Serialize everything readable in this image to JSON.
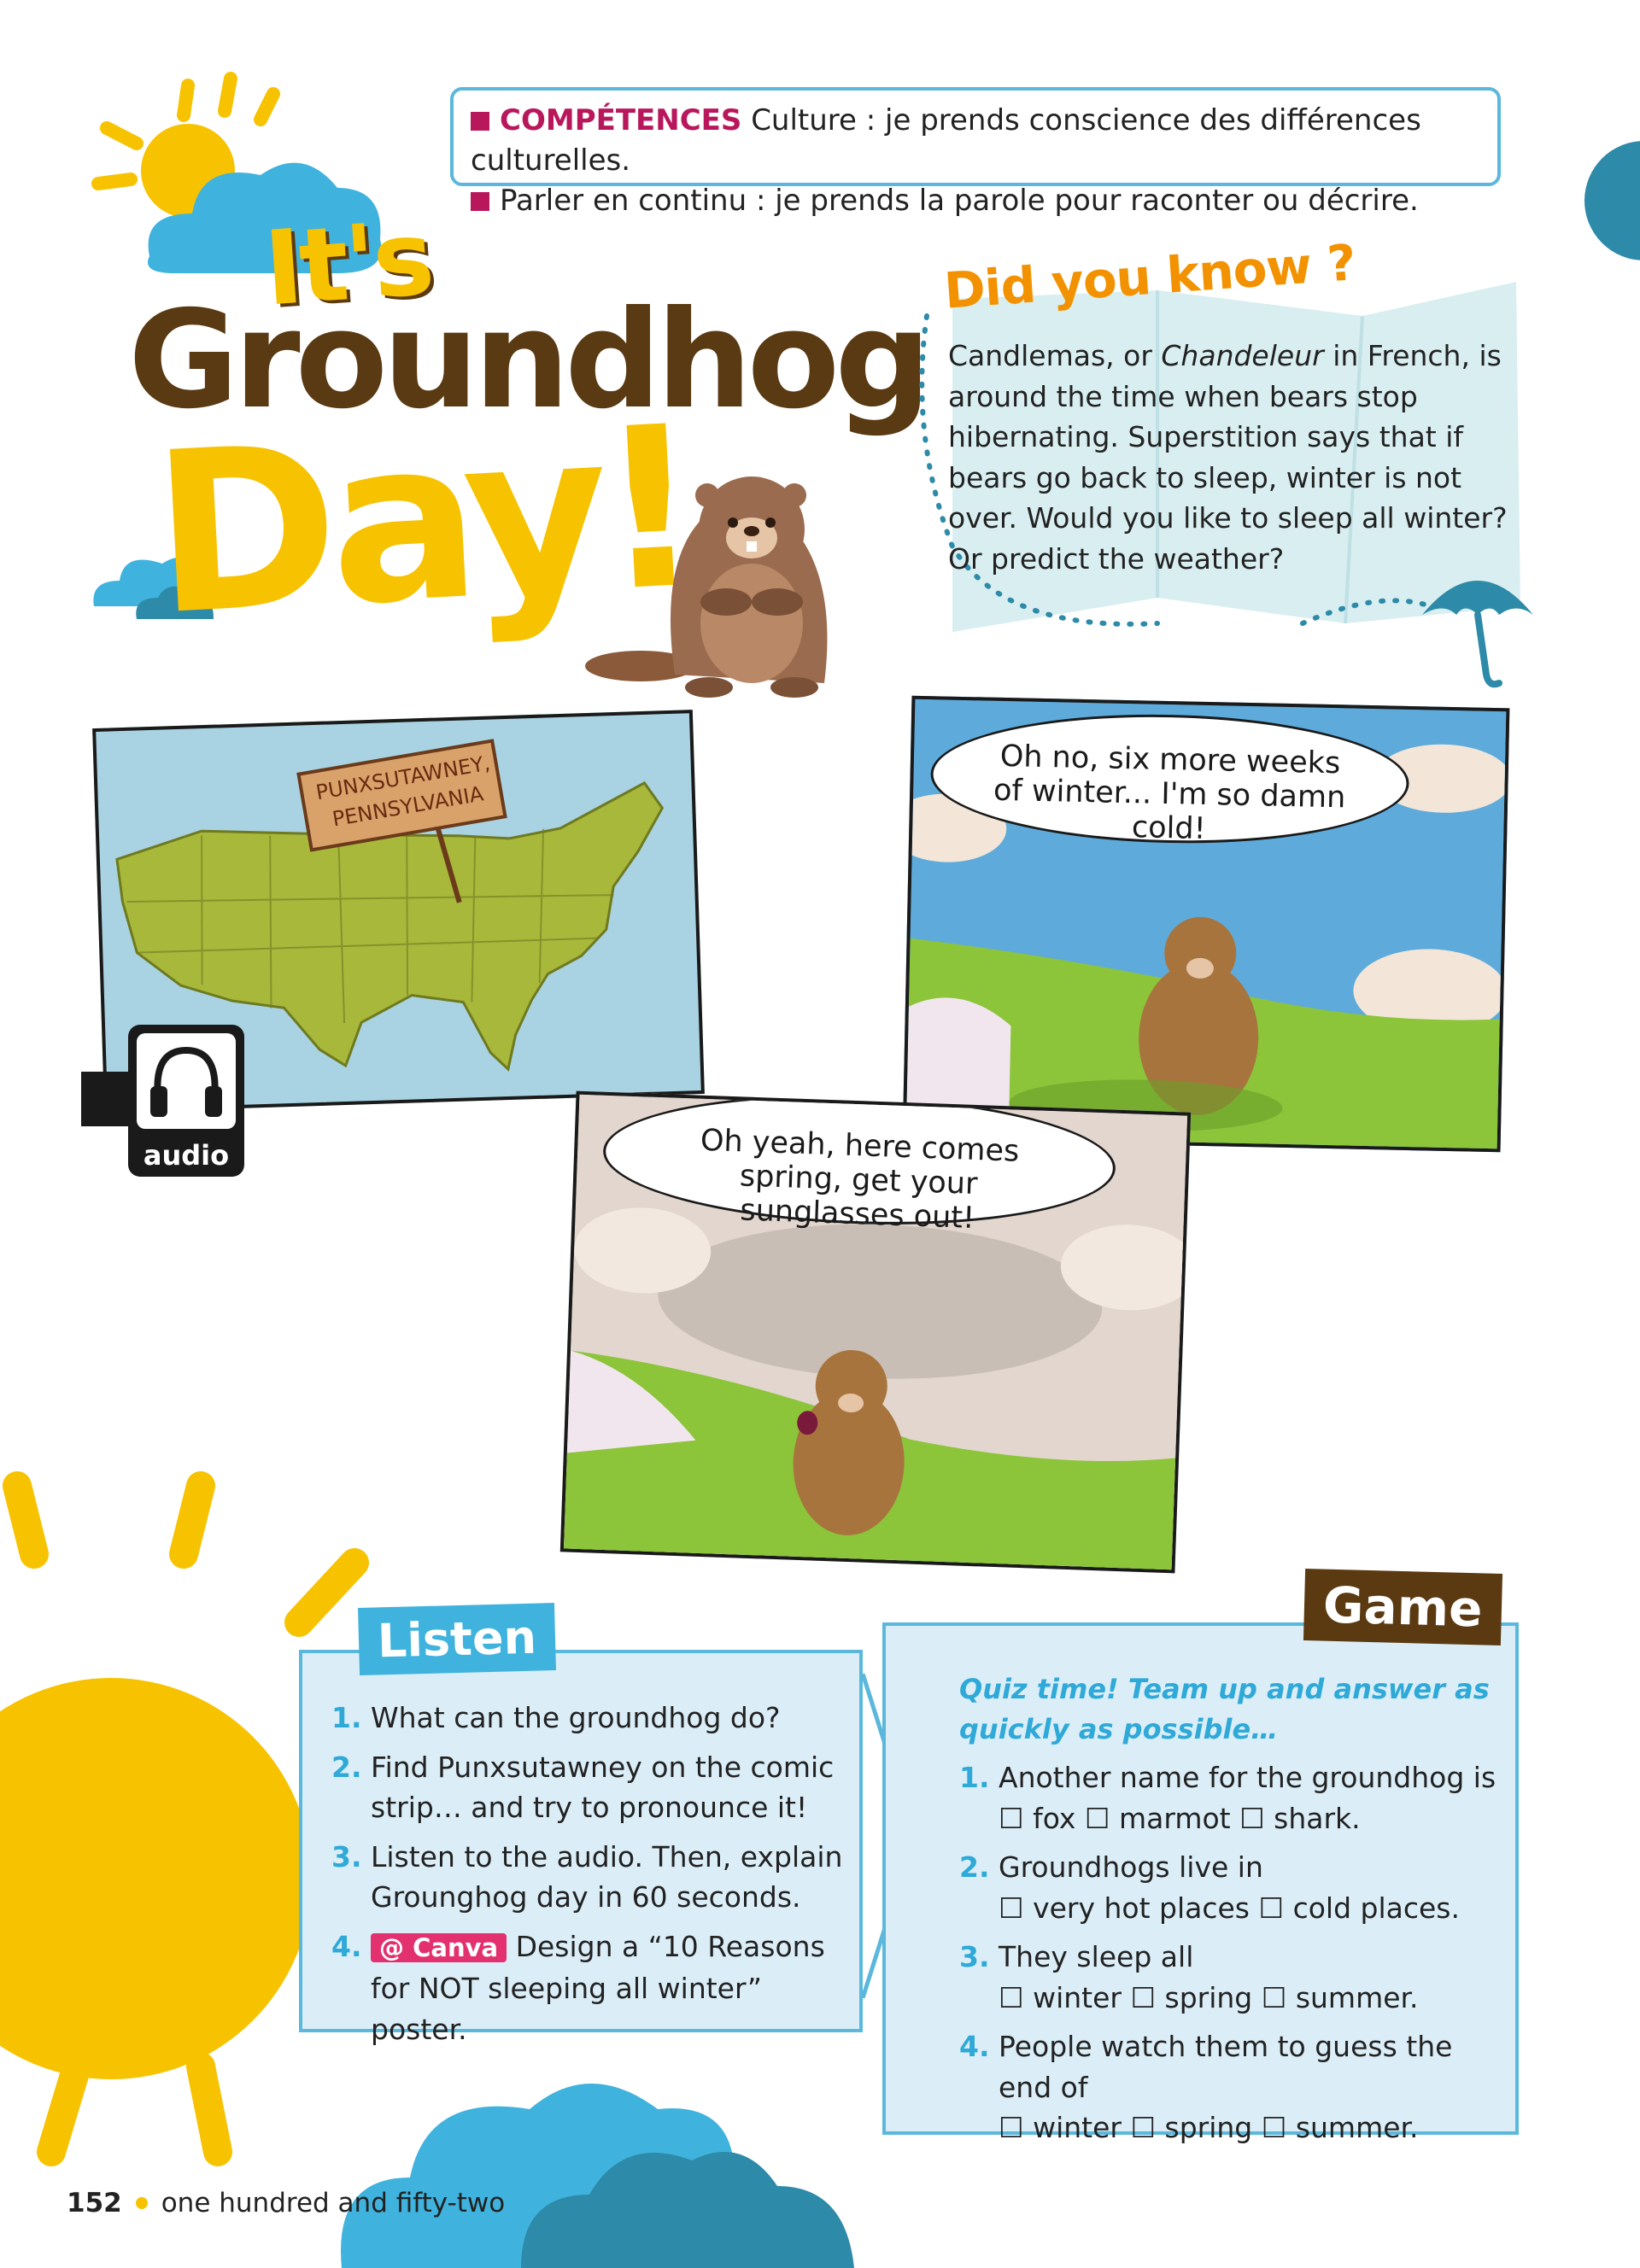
{
  "competences": {
    "label": "COMPÉTENCES",
    "line1": "Culture : je prends conscience des différences culturelles.",
    "line2": "Parler en continu : je prends la parole pour raconter ou décrire."
  },
  "title": {
    "line1": "It's",
    "line2": "Groundhog",
    "line3": "Day!"
  },
  "did_you_know": {
    "heading": "Did you know ?",
    "text_before": "Candlemas, or ",
    "text_italic": "Chandeleur",
    "text_after": " in French, is around the time when bears stop hibernating. Superstition says that if bears go back to sleep, winter is not over. Would you like to sleep all winter? Or predict the weather?"
  },
  "comic": {
    "sign_line1": "PUNXSUTAWNEY,",
    "sign_line2": "PENNSYLVANIA",
    "bubble1": "Oh no, six more weeks of winter... I'm so damn cold!",
    "bubble2": "Oh yeah, here comes spring, get your sunglasses out!"
  },
  "audio": {
    "label": "audio"
  },
  "listen": {
    "title": "Listen",
    "items": [
      {
        "num": "1.",
        "text": "What can the groundhog do?"
      },
      {
        "num": "2.",
        "text": "Find Punxsutawney on the comic strip… and try to pronounce it!"
      },
      {
        "num": "3.",
        "text": "Listen to the audio. Then, explain Grounghog day in 60 seconds."
      },
      {
        "num": "4.",
        "badge": "@ Canva",
        "text": "Design a “10 Reasons for NOT sleeping all winter” poster."
      }
    ]
  },
  "game": {
    "title": "Game",
    "intro": "Quiz time! Team up and answer as quickly as possible…",
    "items": [
      {
        "num": "1.",
        "q": "Another name for the groundhog is",
        "opts": "☐ fox ☐ marmot ☐ shark."
      },
      {
        "num": "2.",
        "q": "Groundhogs live in",
        "opts": "☐ very hot places ☐ cold places."
      },
      {
        "num": "3.",
        "q": "They sleep all",
        "opts": "☐ winter ☐ spring ☐ summer."
      },
      {
        "num": "4.",
        "q": "People watch them to guess the end of",
        "opts": "☐ winter ☐ spring ☐ summer."
      }
    ]
  },
  "footer": {
    "page_number": "152",
    "page_words": "one hundred and fifty-two"
  },
  "colors": {
    "accent_pink": "#b8175c",
    "blue": "#2fa9d8",
    "yellow": "#f7c300",
    "brown": "#5a3a12",
    "orange": "#f39200"
  }
}
